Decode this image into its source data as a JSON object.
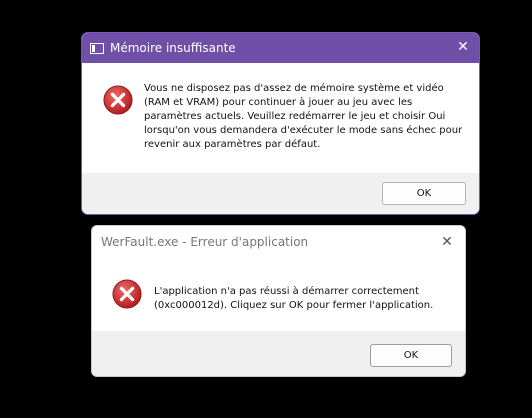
{
  "dialog_memory": {
    "title": "Mémoire insuffisante",
    "message": "Vous ne disposez pas d'assez de mémoire système et vidéo (RAM et VRAM) pour continuer à jouer au jeu avec les paramètres actuels. Veuillez redémarrer le jeu et choisir Oui lorsqu'on vous demandera d'exécuter le mode sans échec pour revenir aux paramètres par défaut.",
    "ok_label": "OK",
    "close_glyph": "✕",
    "title_color": "#6f4fa8"
  },
  "dialog_werfault": {
    "title": "WerFault.exe - Erreur d'application",
    "message": "L'application n'a pas réussi à démarrer correctement (0xc000012d). Cliquez sur OK pour fermer l'application.",
    "ok_label": "OK",
    "close_glyph": "✕"
  },
  "icons": {
    "error": "error-icon",
    "app": "app-window-icon",
    "close": "close-icon"
  },
  "colors": {
    "background": "#000000",
    "error_red": "#c92a2a"
  }
}
